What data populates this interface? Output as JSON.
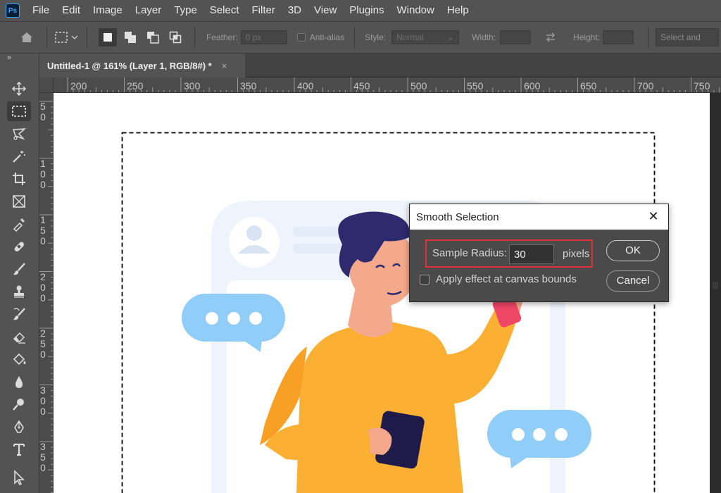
{
  "app": {
    "logo": "Ps"
  },
  "menu": [
    "File",
    "Edit",
    "Image",
    "Layer",
    "Type",
    "Select",
    "Filter",
    "3D",
    "View",
    "Plugins",
    "Window",
    "Help"
  ],
  "options": {
    "feather_label": "Feather:",
    "feather_value": "0 px",
    "antialias_label": "Anti-alias",
    "style_label": "Style:",
    "style_value": "Normal",
    "width_label": "Width:",
    "height_label": "Height:",
    "select_and_mask": "Select and"
  },
  "toolbar": {
    "collapse": "»",
    "tools": [
      "move-tool",
      "rectangular-marquee-tool",
      "lasso-tool",
      "magic-wand-tool",
      "crop-tool",
      "frame-tool",
      "eyedropper-tool",
      "healing-brush-tool",
      "brush-tool",
      "clone-stamp-tool",
      "history-brush-tool",
      "eraser-tool",
      "paint-bucket-tool",
      "blur-tool",
      "dodge-tool",
      "pen-tool",
      "type-tool",
      "path-selection-tool"
    ],
    "active_tool": "rectangular-marquee-tool"
  },
  "document": {
    "tab_title": "Untitled-1 @ 161% (Layer 1, RGB/8#) *",
    "close": "×"
  },
  "rulers": {
    "horizontal": [
      "200",
      "250",
      "300",
      "350",
      "400",
      "450",
      "500",
      "550",
      "600",
      "650",
      "700",
      "750"
    ],
    "vertical": [
      "50",
      "100",
      "150",
      "200",
      "250",
      "300",
      "350"
    ]
  },
  "dialog": {
    "title": "Smooth Selection",
    "close": "✕",
    "radius_label": "Sample Radius:",
    "radius_value": "30",
    "radius_unit": "pixels",
    "apply_label": "Apply effect at canvas bounds",
    "apply_checked": false,
    "ok": "OK",
    "cancel": "Cancel"
  },
  "colors": {
    "chrome": "#535353",
    "highlight": "#e0313c",
    "shirt": "#fbb034",
    "bubble": "#90cdf8",
    "hair": "#2d2a6e",
    "phone_frame": "#eef4fc"
  }
}
